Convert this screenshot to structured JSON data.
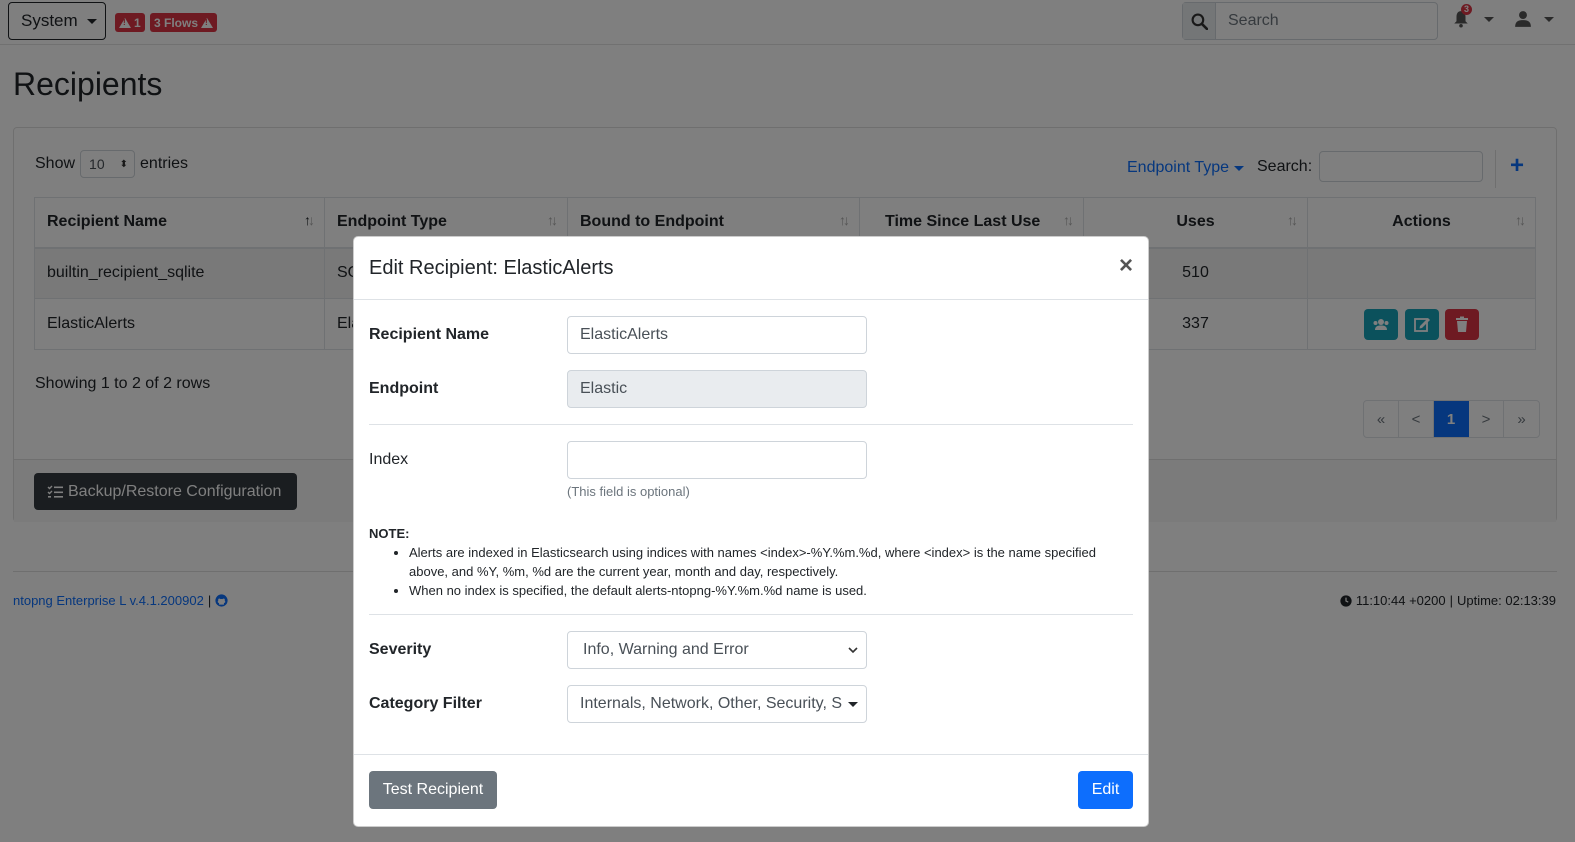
{
  "navbar": {
    "system_label": "System",
    "alert_count": "1",
    "flows_badge": "3 Flows",
    "search_placeholder": "Search",
    "notification_count": "3"
  },
  "page": {
    "title": "Recipients"
  },
  "table_controls": {
    "show_label": "Show",
    "entries_value": "10",
    "entries_label": "entries",
    "endpoint_type_filter": "Endpoint Type",
    "search_label": "Search:",
    "add_icon": "plus-icon"
  },
  "table": {
    "columns": [
      "Recipient Name",
      "Endpoint Type",
      "Bound to Endpoint",
      "Time Since Last Use",
      "Uses",
      "Actions"
    ],
    "rows": [
      {
        "name": "builtin_recipient_sqlite",
        "endpoint_type": "SQ",
        "uses": "510"
      },
      {
        "name": "ElasticAlerts",
        "endpoint_type": "Ela",
        "uses": "337"
      }
    ]
  },
  "pagination": {
    "showing_text": "Showing 1 to 2 of 2 rows",
    "first": "«",
    "prev": "<",
    "current": "1",
    "next": ">",
    "last": "»"
  },
  "card_footer": {
    "backup_label": "Backup/Restore Configuration"
  },
  "footer": {
    "version_link": "ntopng Enterprise L v.4.1.200902",
    "separator": "|",
    "time": "11:10:44 +0200",
    "uptime": "Uptime: 02:13:39"
  },
  "modal": {
    "title": "Edit Recipient: ElasticAlerts",
    "close_symbol": "×",
    "recipient_name_label": "Recipient Name",
    "recipient_name_value": "ElasticAlerts",
    "endpoint_label": "Endpoint",
    "endpoint_value": "Elastic",
    "index_label": "Index",
    "index_value": "",
    "index_hint": "(This field is optional)",
    "note_title": "NOTE:",
    "note_items": [
      "Alerts are indexed in Elasticsearch using indices with names <index>-%Y.%m.%d, where <index> is the name specified above, and %Y, %m, %d are the current year, month and day, respectively.",
      "When no index is specified, the default alerts-ntopng-%Y.%m.%d name is used."
    ],
    "severity_label": "Severity",
    "severity_value": "Info, Warning and Error",
    "category_label": "Category Filter",
    "category_value": "Internals, Network, Other, Security, System",
    "test_button": "Test Recipient",
    "edit_button": "Edit"
  },
  "colors": {
    "primary": "#0d6efd",
    "danger": "#dc3545",
    "info": "#17a2b8",
    "secondary": "#6c757d",
    "dark": "#343a40"
  }
}
